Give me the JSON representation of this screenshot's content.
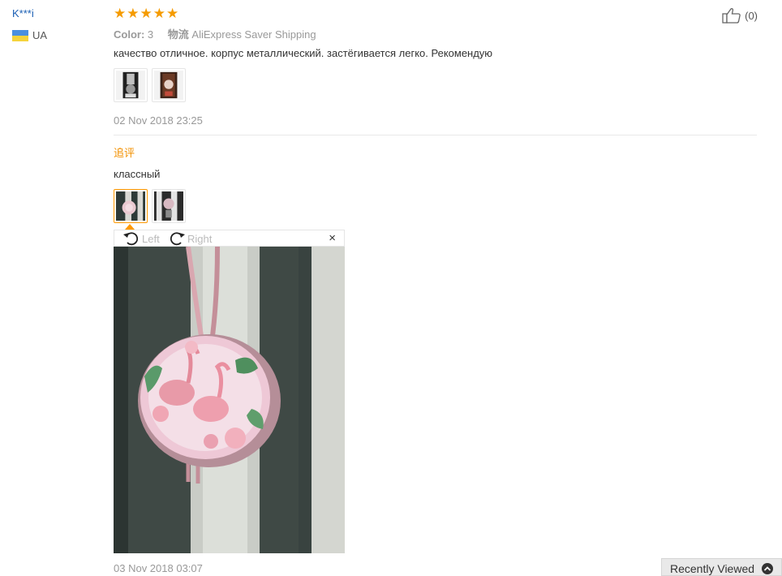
{
  "reviewer": {
    "name": "K***i",
    "country": "UA"
  },
  "rating": {
    "stars": 5,
    "max": 5
  },
  "meta": {
    "color_label": "Color:",
    "color_value": "3",
    "shipping_label": "物流",
    "shipping_value": "AliExpress Saver Shipping"
  },
  "helpful": {
    "count": "(0)",
    "icon": "thumbs-up-icon"
  },
  "review": {
    "text": "качество отличное. корпус металлический. застёгивается легко. Рекомендую",
    "date": "02 Nov 2018 23:25"
  },
  "followup": {
    "label": "追评",
    "text": "классный",
    "date": "03 Nov 2018 03:07"
  },
  "viewer": {
    "rotate_left": "Left",
    "rotate_right": "Right",
    "close": "×"
  },
  "recently_viewed": {
    "label": "Recently Viewed"
  },
  "colors": {
    "accent": "#f90",
    "star": "#f59b00",
    "link": "#1a5fb4",
    "followup": "#f29000"
  }
}
